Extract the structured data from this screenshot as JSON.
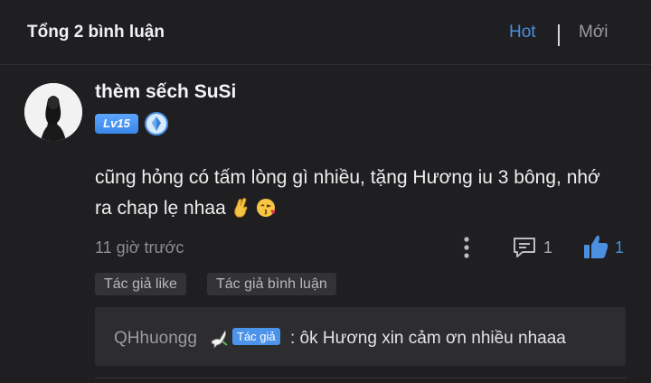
{
  "header": {
    "title": "Tổng 2 bình luận",
    "sort_hot": "Hot",
    "sort_new": "Mới"
  },
  "comment": {
    "username": "thèm sếch SuSi",
    "level": "Lv15",
    "rank_icon": "rank-diamond-icon",
    "text": "cũng hỏng có tấm lòng gì nhiều, tặng Hương iu 3 bông, nhớ ra chap lẹ nhaa",
    "emojis": [
      "crossed-fingers-emoji",
      "kissing-face-emoji"
    ],
    "timestamp": "11 giờ trước",
    "reply_count": "1",
    "like_count": "1",
    "tags": [
      "Tác giả like",
      "Tác giả bình luận"
    ]
  },
  "reply": {
    "author": "QHhuongg",
    "author_icon": "dove-icon",
    "badge": "Tác giả",
    "text": ": ôk Hương xin cảm ơn nhiều nhaaa"
  },
  "colors": {
    "background": "#1f1f21",
    "accent": "#4a8fe0",
    "muted": "#8e8e93"
  }
}
